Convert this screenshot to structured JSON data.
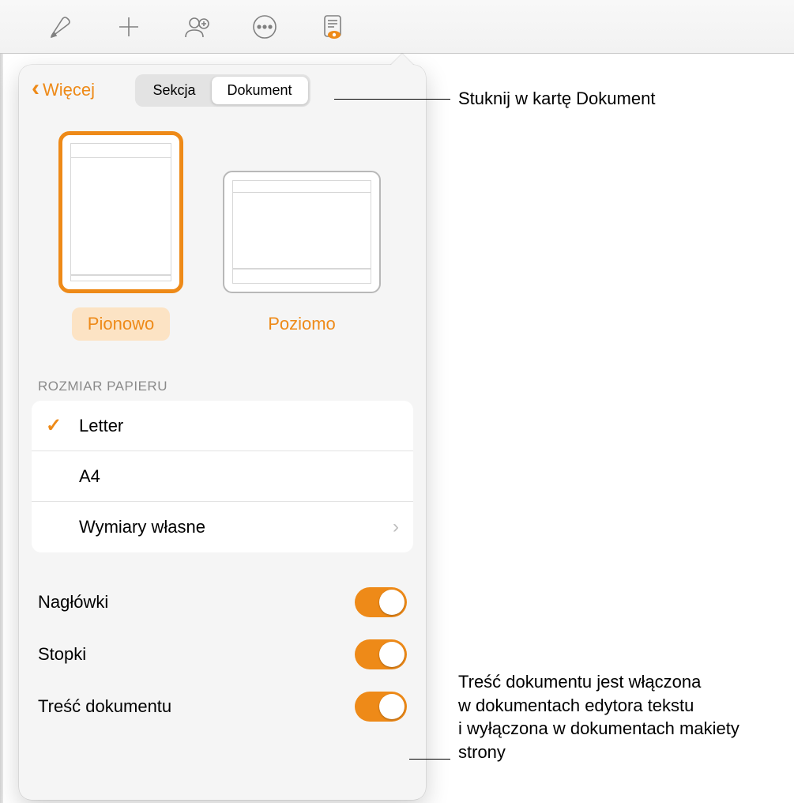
{
  "toolbar_icons": {
    "format": "format-brush-icon",
    "insert": "plus-icon",
    "collab": "person-add-icon",
    "more": "more-circle-icon",
    "doc": "document-preview-icon"
  },
  "panel": {
    "back_label": "Więcej",
    "tabs": {
      "section": "Sekcja",
      "document": "Dokument"
    },
    "orientation": {
      "portrait": "Pionowo",
      "landscape": "Poziomo"
    },
    "paper_size_header": "ROZMIAR PAPIERU",
    "paper_sizes": {
      "letter": "Letter",
      "a4": "A4",
      "custom": "Wymiary własne"
    },
    "toggles": {
      "headers": "Nagłówki",
      "footers": "Stopki",
      "body": "Treść dokumentu"
    }
  },
  "callouts": {
    "tap_document": "Stuknij w kartę Dokument",
    "body_text": "Treść dokumentu jest włączona w dokumentach edytora tekstu i wyłączona w dokumentach makiety strony"
  }
}
